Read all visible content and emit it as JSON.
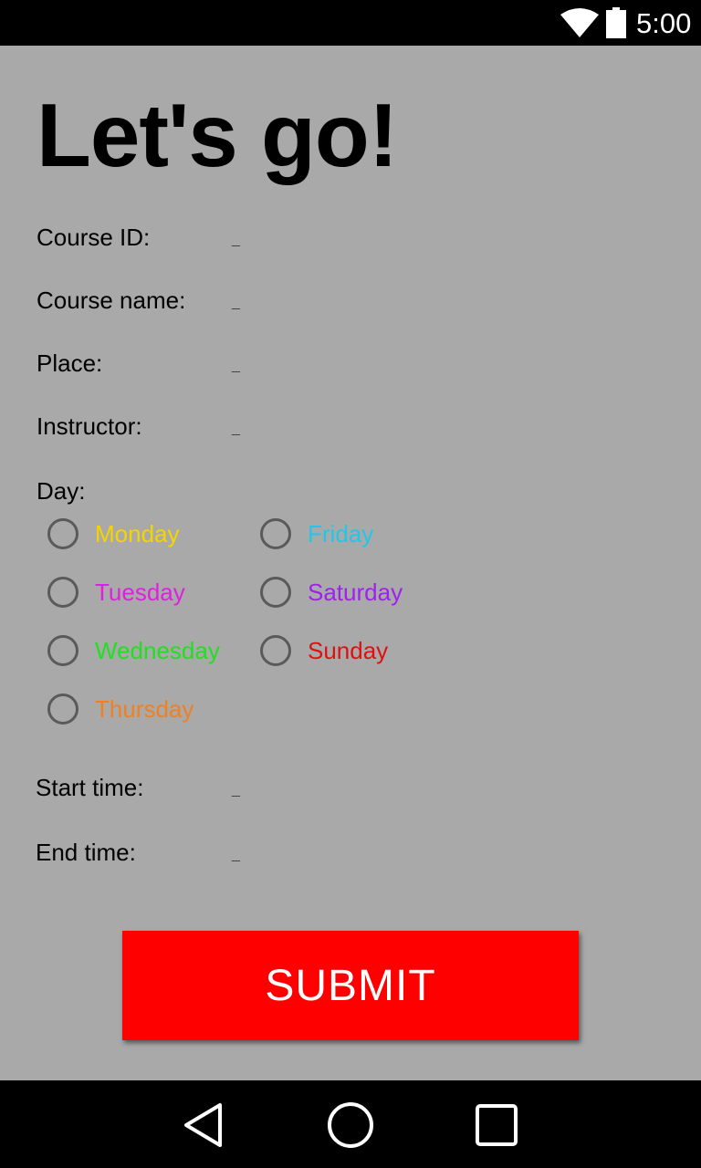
{
  "status_bar": {
    "time": "5:00"
  },
  "title": "Let's go!",
  "fields": {
    "course_id": {
      "label": "Course ID:",
      "value": "_"
    },
    "course_name": {
      "label": "Course name:",
      "value": "_"
    },
    "place": {
      "label": "Place:",
      "value": "_"
    },
    "instructor": {
      "label": "Instructor:",
      "value": "_"
    }
  },
  "day": {
    "label": "Day:",
    "options": [
      {
        "label": "Monday",
        "color": "#f5d400"
      },
      {
        "label": "Tuesday",
        "color": "#e020e0"
      },
      {
        "label": "Wednesday",
        "color": "#20e020"
      },
      {
        "label": "Thursday",
        "color": "#f08020"
      },
      {
        "label": "Friday",
        "color": "#20c8e8"
      },
      {
        "label": "Saturday",
        "color": "#a020f0"
      },
      {
        "label": "Sunday",
        "color": "#e01010"
      }
    ]
  },
  "times": {
    "start": {
      "label": "Start time:",
      "value": "_"
    },
    "end": {
      "label": "End time:",
      "value": "_"
    }
  },
  "submit_label": "SUBMIT",
  "colors": {
    "background": "#a9a9a9",
    "submit": "#ff0000"
  }
}
